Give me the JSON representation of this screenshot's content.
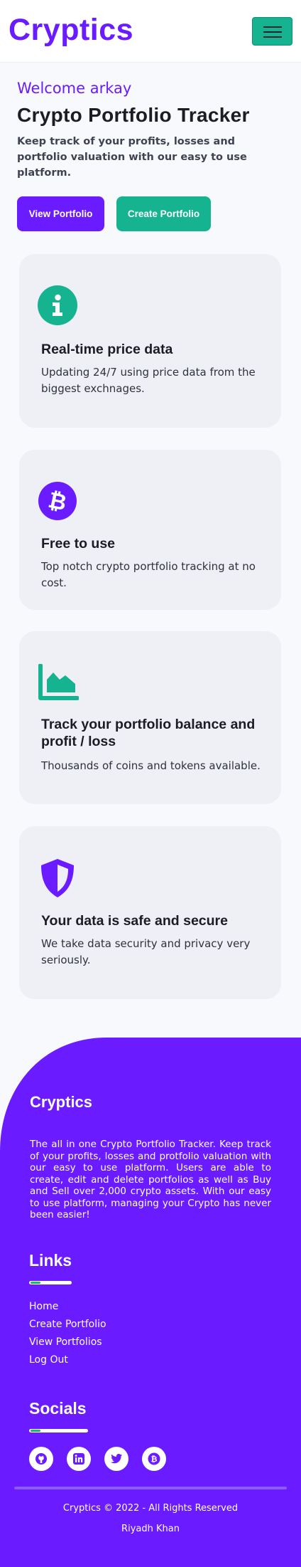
{
  "navbar": {
    "brand": "Cryptics",
    "menu_icon": "hamburger-menu-icon"
  },
  "hero": {
    "welcome": "Welcome arkay",
    "title": "Crypto Portfolio Tracker",
    "description": "Keep track of your profits, losses and portfolio valuation with our easy to use platform.",
    "view_button": "View Portfolio",
    "create_button": "Create Portfolio"
  },
  "features": [
    {
      "icon": "info-icon",
      "title": "Real-time price data",
      "description": "Updating 24/7 using price data from the biggest exchnages."
    },
    {
      "icon": "bitcoin-icon",
      "title": "Free to use",
      "description": "Top notch crypto portfolio tracking at no cost."
    },
    {
      "icon": "area-chart-icon",
      "title": "Track your portfolio balance and profit / loss",
      "description": "Thousands of coins and tokens available."
    },
    {
      "icon": "shield-icon",
      "title": "Your data is safe and secure",
      "description": "We take data security and privacy very seriously."
    }
  ],
  "footer": {
    "brand": "Cryptics",
    "about": "The all in one Crypto Portfolio Tracker. Keep track of your profits, losses and protfolio valuation with our easy to use platform. Users are able to create, edit and delete portfolios as well as Buy and Sell over 2,000 crypto assets. With our easy to use platform, managing your Crypto has never been easier!",
    "links_heading": "Links",
    "links": [
      "Home",
      "Create Portfolio",
      "View Portfolios",
      "Log Out"
    ],
    "socials_heading": "Socials",
    "socials": [
      "github-icon",
      "linkedin-icon",
      "twitter-icon",
      "bitcoin-icon"
    ],
    "copyright": "Cryptics © 2022 - All Rights Reserved",
    "author": "Riyadh Khan"
  },
  "colors": {
    "primary": "#6a1bff",
    "accent": "#15b38f",
    "card": "#eef0f6"
  }
}
